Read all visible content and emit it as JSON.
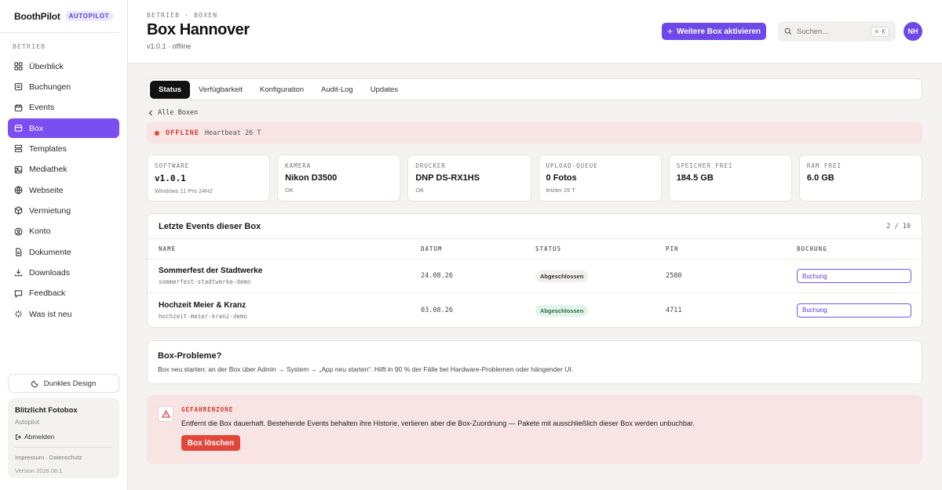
{
  "brand": {
    "name": "BoothPilot",
    "badge": "AUTOPILOT"
  },
  "sidebar": {
    "section": "BETRIEB",
    "items": [
      {
        "label": "Überblick",
        "icon": "grid-icon"
      },
      {
        "label": "Buchungen",
        "icon": "bookings-icon"
      },
      {
        "label": "Events",
        "icon": "calendar-icon"
      },
      {
        "label": "Box",
        "icon": "box-icon",
        "active": true
      },
      {
        "label": "Templates",
        "icon": "layers-icon"
      },
      {
        "label": "Mediathek",
        "icon": "image-icon"
      },
      {
        "label": "Webseite",
        "icon": "globe-icon"
      },
      {
        "label": "Vermietung",
        "icon": "package-icon"
      },
      {
        "label": "Konto",
        "icon": "user-icon"
      },
      {
        "label": "Dokumente",
        "icon": "document-icon"
      },
      {
        "label": "Downloads",
        "icon": "download-icon"
      },
      {
        "label": "Feedback",
        "icon": "chat-icon"
      },
      {
        "label": "Was ist neu",
        "icon": "sparkle-icon"
      }
    ],
    "theme_label": "Dunkles Design",
    "account": {
      "name": "Blitzlicht Fotobox",
      "plan": "Autopilot",
      "logout": "Abmelden",
      "impressum": "Impressum",
      "datenschutz": "Datenschutz",
      "version": "Version 2026.08.1"
    }
  },
  "header": {
    "breadcrumb": "BETRIEB · BOXEN",
    "title": "Box Hannover",
    "subtitle": "v1.0.1 · offline",
    "primary_button": "Weitere Box aktivieren",
    "search_placeholder": "Suchen...",
    "shortcut": "⌘ K",
    "avatar": "NH"
  },
  "tabs": [
    "Status",
    "Verfügbarkeit",
    "Konfiguration",
    "Audit-Log",
    "Updates"
  ],
  "back_link": "Alle Boxen",
  "status_banner": {
    "state": "OFFLINE",
    "heartbeat": "Heartbeat 26 T"
  },
  "stats": [
    {
      "label": "SOFTWARE",
      "value": "v1.0.1",
      "sub": "Windows 11 Pro 24H2"
    },
    {
      "label": "KAMERA",
      "value": "Nikon D3500",
      "sub": "OK"
    },
    {
      "label": "DRUCKER",
      "value": "DNP DS-RX1HS",
      "sub": "OK"
    },
    {
      "label": "UPLOAD-QUEUE",
      "value": "0 Fotos",
      "sub": "letzter 26 T"
    },
    {
      "label": "SPEICHER FREI",
      "value": "184.5 GB",
      "sub": ""
    },
    {
      "label": "RAM FREI",
      "value": "6.0 GB",
      "sub": ""
    }
  ],
  "events": {
    "title": "Letzte Events dieser Box",
    "count": "2 / 10",
    "columns": [
      "NAME",
      "DATUM",
      "STATUS",
      "PIN",
      "BUCHUNG"
    ],
    "rows": [
      {
        "name": "Sommerfest der Stadtwerke",
        "slug": "sommerfest-stadtwerke-demo",
        "date": "24.08.26",
        "status": "Abgeschlossen",
        "pin": "2580",
        "booking": "Buchung"
      },
      {
        "name": "Hochzeit Meier & Kranz",
        "slug": "hochzeit-meier-kranz-demo",
        "date": "03.08.26",
        "status": "Abgeschlossen",
        "pin": "4711",
        "booking": "Buchung"
      }
    ]
  },
  "problems": {
    "title": "Box-Probleme?",
    "text": "Box neu starten: an der Box über Admin → System → „App neu starten“. Hilft in 90 % der Fälle bei Hardware-Problemen oder hängender UI."
  },
  "danger": {
    "label": "GEFAHRENZONE",
    "text": "Entfernt die Box dauerhaft. Bestehende Events behalten ihre Historie, verlieren aber die Box-Zuordnung — Pakete mit ausschließlich dieser Box werden unbuchbar.",
    "button": "Box löschen"
  },
  "colors": {
    "accent": "#6f48e8",
    "danger": "#e2453a",
    "danger_bg": "#f7e4e3"
  }
}
